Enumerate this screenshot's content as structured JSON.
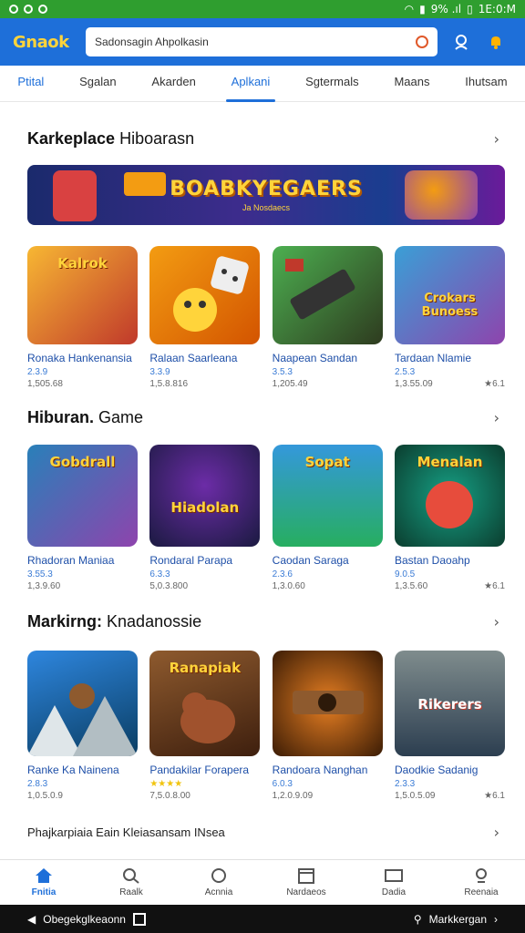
{
  "status_bar": {
    "left_icons": [
      "circle-icon",
      "circle-icon",
      "circle-icon"
    ],
    "right_text": "9% .ıl",
    "time": "1E:0:M"
  },
  "header": {
    "logo": "Gnaok",
    "search_value": "Sadonsagin Ahpolkasin",
    "icons": [
      "search-icon",
      "user-icon",
      "bell-icon"
    ]
  },
  "tabs": [
    {
      "label": "Ptital"
    },
    {
      "label": "Sgalan"
    },
    {
      "label": "Akarden"
    },
    {
      "label": "Aplkani"
    },
    {
      "label": "Sgtermals"
    },
    {
      "label": "Maans"
    },
    {
      "label": "Ihutsam"
    }
  ],
  "sections": [
    {
      "title": "Karkeplace",
      "subtitle": "Hiboarasn",
      "banner": {
        "title": "BOABKYEGAERS",
        "subtitle": "Ja Nosdaecs"
      },
      "cards": [
        {
          "title": "Ronaka Hankenansia",
          "rating": "2.3.9",
          "count": "1,505.68",
          "thumb_label": "Kalrok",
          "thumb_colors": [
            "#f7b733",
            "#c0392b"
          ]
        },
        {
          "title": "Ralaan Saarleana",
          "rating": "3.3.9",
          "count": "1,5.8.816",
          "thumb_label": "",
          "thumb_colors": [
            "#f39c12",
            "#d35400"
          ]
        },
        {
          "title": "Naapean Sandan",
          "rating": "3.5.3",
          "count": "1,205.49",
          "thumb_label": "",
          "thumb_colors": [
            "#4caf50",
            "#2e3b1f"
          ]
        },
        {
          "title": "Tardaan Nlamie",
          "rating": "2.5.3",
          "count": "1,3.55.09",
          "thumb_label": "Crokars Bunoess",
          "thumb_colors": [
            "#3a9fd6",
            "#8e44ad"
          ],
          "extra": "★6.1"
        }
      ]
    },
    {
      "title": "Hiburan.",
      "subtitle": "Game",
      "cards": [
        {
          "title": "Rhadoran Maniaa",
          "rating": "3.55.3",
          "count": "1,3.9.60",
          "thumb_label": "Gobdrall",
          "thumb_colors": [
            "#2980b9",
            "#8e44ad"
          ]
        },
        {
          "title": "Rondaral Parapa",
          "rating": "6.3.3",
          "count": "5,0.3.800",
          "thumb_label": "Hiadolan",
          "thumb_colors": [
            "#6c2ca7",
            "#1a1a40"
          ]
        },
        {
          "title": "Caodan Saraga",
          "rating": "2.3.6",
          "count": "1,3.0.60",
          "thumb_label": "Sopat",
          "thumb_colors": [
            "#3498db",
            "#27ae60"
          ]
        },
        {
          "title": "Bastan Daoahp",
          "rating": "9.0.5",
          "count": "1,3.5.60",
          "thumb_label": "Menalan",
          "thumb_colors": [
            "#16a085",
            "#0b3d2e"
          ],
          "extra": "★6.1"
        }
      ]
    },
    {
      "title": "Markirng:",
      "subtitle": "Knadanossie",
      "cards": [
        {
          "title": "Ranke Ka Nainena",
          "rating": "2.8.3",
          "count": "1,0.5.0.9",
          "thumb_label": "",
          "thumb_colors": [
            "#2e86de",
            "#0a3d62"
          ]
        },
        {
          "title": "Pandakilar Forapera",
          "rating": "★★★★",
          "count": "7,5.0.8.00",
          "thumb_label": "Ranapiak",
          "thumb_colors": [
            "#8e5a2e",
            "#3e1f0e"
          ]
        },
        {
          "title": "Randoara Nanghan",
          "rating": "6.0.3",
          "count": "1,2.0.9.09",
          "thumb_label": "",
          "thumb_colors": [
            "#e67e22",
            "#3b1c05"
          ]
        },
        {
          "title": "Daodkie Sadanig",
          "rating": "2.3.3",
          "count": "1,5.0.5.09",
          "thumb_label": "Rikerers",
          "thumb_colors": [
            "#7f8c8d",
            "#2c3e50"
          ],
          "extra": "★6.1"
        }
      ]
    }
  ],
  "bottom_link": "Phajkarpiaia Eain Kleiasansam INsea",
  "bottom_nav": [
    {
      "label": "Fnitia",
      "icon": "home-icon",
      "active": true
    },
    {
      "label": "Raalk",
      "icon": "search-icon"
    },
    {
      "label": "Acnnia",
      "icon": "chat-icon"
    },
    {
      "label": "Nardaeos",
      "icon": "calendar-icon"
    },
    {
      "label": "Dadia",
      "icon": "message-icon"
    },
    {
      "label": "Reenaia",
      "icon": "profile-icon"
    }
  ],
  "system_bar": {
    "left_text": "Obegekglkeaonn",
    "right_text": "Markkergan"
  }
}
